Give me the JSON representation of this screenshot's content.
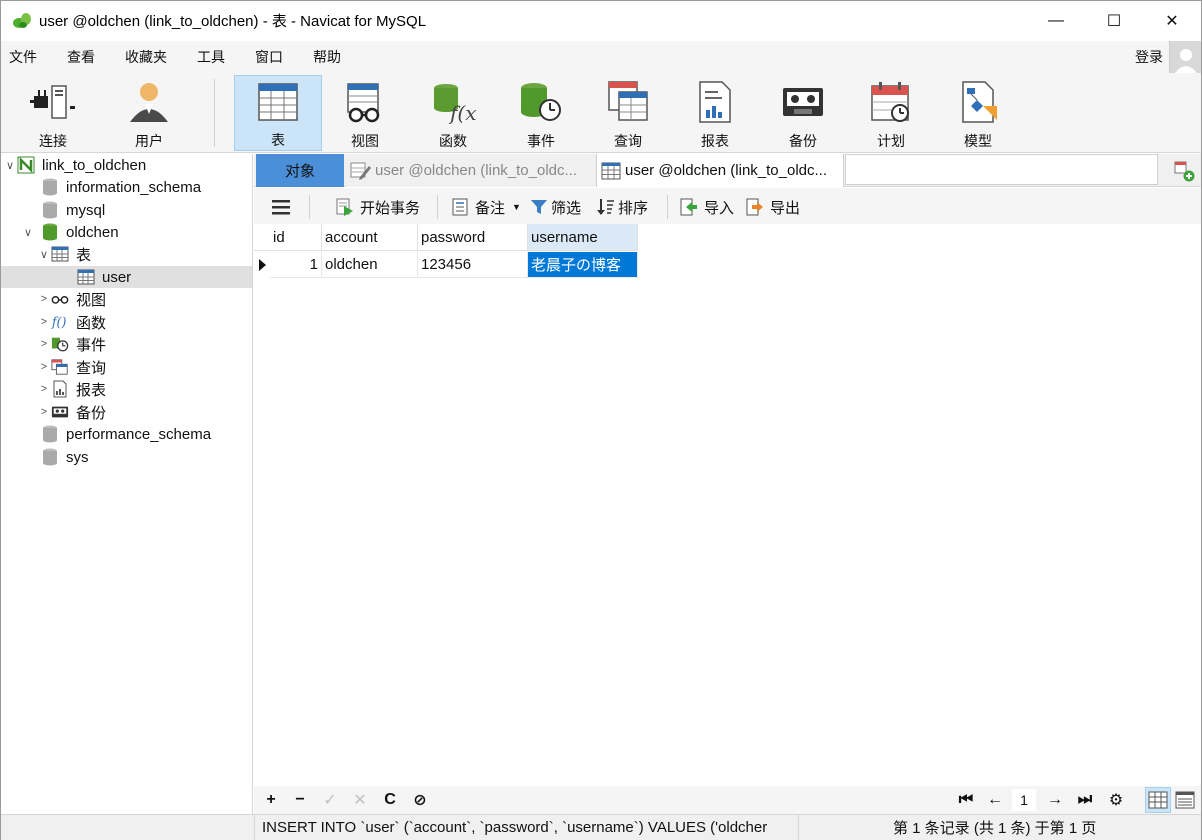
{
  "window": {
    "title": "user @oldchen (link_to_oldchen) - 表 - Navicat for MySQL",
    "minimize": "—",
    "maximize": "☐",
    "close": "✕"
  },
  "menu": {
    "items": [
      "文件",
      "查看",
      "收藏夹",
      "工具",
      "窗口",
      "帮助"
    ],
    "login": "登录"
  },
  "ribbon": {
    "buttons": [
      {
        "label": "连接",
        "icon": "connect-icon"
      },
      {
        "label": "用户",
        "icon": "user-icon"
      },
      {
        "label": "表",
        "icon": "table-icon"
      },
      {
        "label": "视图",
        "icon": "view-icon"
      },
      {
        "label": "函数",
        "icon": "function-icon"
      },
      {
        "label": "事件",
        "icon": "event-icon"
      },
      {
        "label": "查询",
        "icon": "query-icon"
      },
      {
        "label": "报表",
        "icon": "report-icon"
      },
      {
        "label": "备份",
        "icon": "backup-icon"
      },
      {
        "label": "计划",
        "icon": "schedule-icon"
      },
      {
        "label": "模型",
        "icon": "model-icon"
      }
    ],
    "active": "表"
  },
  "tree": {
    "connection": "link_to_oldchen",
    "databases": [
      "information_schema",
      "mysql",
      "oldchen",
      "performance_schema",
      "sys"
    ],
    "oldchen_children": {
      "tables_label": "表",
      "table_user": "user",
      "view": "视图",
      "function": "函数",
      "event": "事件",
      "query": "查询",
      "report": "报表",
      "backup": "备份"
    }
  },
  "tabs": {
    "objects": "对象",
    "tab2": "user @oldchen (link_to_oldc...",
    "tab3": "user @oldchen (link_to_oldc..."
  },
  "toolbar": {
    "begin_transaction": "开始事务",
    "memo": "备注",
    "filter": "筛选",
    "sort": "排序",
    "import": "导入",
    "export": "导出"
  },
  "grid": {
    "columns": [
      "id",
      "account",
      "password",
      "username"
    ],
    "rows": [
      {
        "id": "1",
        "account": "oldchen",
        "password": "123456",
        "username": "老晨子の博客"
      }
    ]
  },
  "bottom_nav": {
    "add": "+",
    "remove": "−",
    "apply": "✓",
    "discard": "✕",
    "refresh": "C",
    "stop": "⊘",
    "first": "⏮",
    "prev": "←",
    "page": "1",
    "next": "→",
    "last": "⏭",
    "settings": "⚙"
  },
  "status": {
    "sql": "INSERT INTO `user` (`account`, `password`, `username`) VALUES ('oldcher",
    "record": "第 1 条记录 (共 1 条) 于第 1 页"
  },
  "colors": {
    "accent": "#0078d7",
    "tab_active": "#4a8fd8",
    "ribbon_active": "#cce4f7"
  }
}
